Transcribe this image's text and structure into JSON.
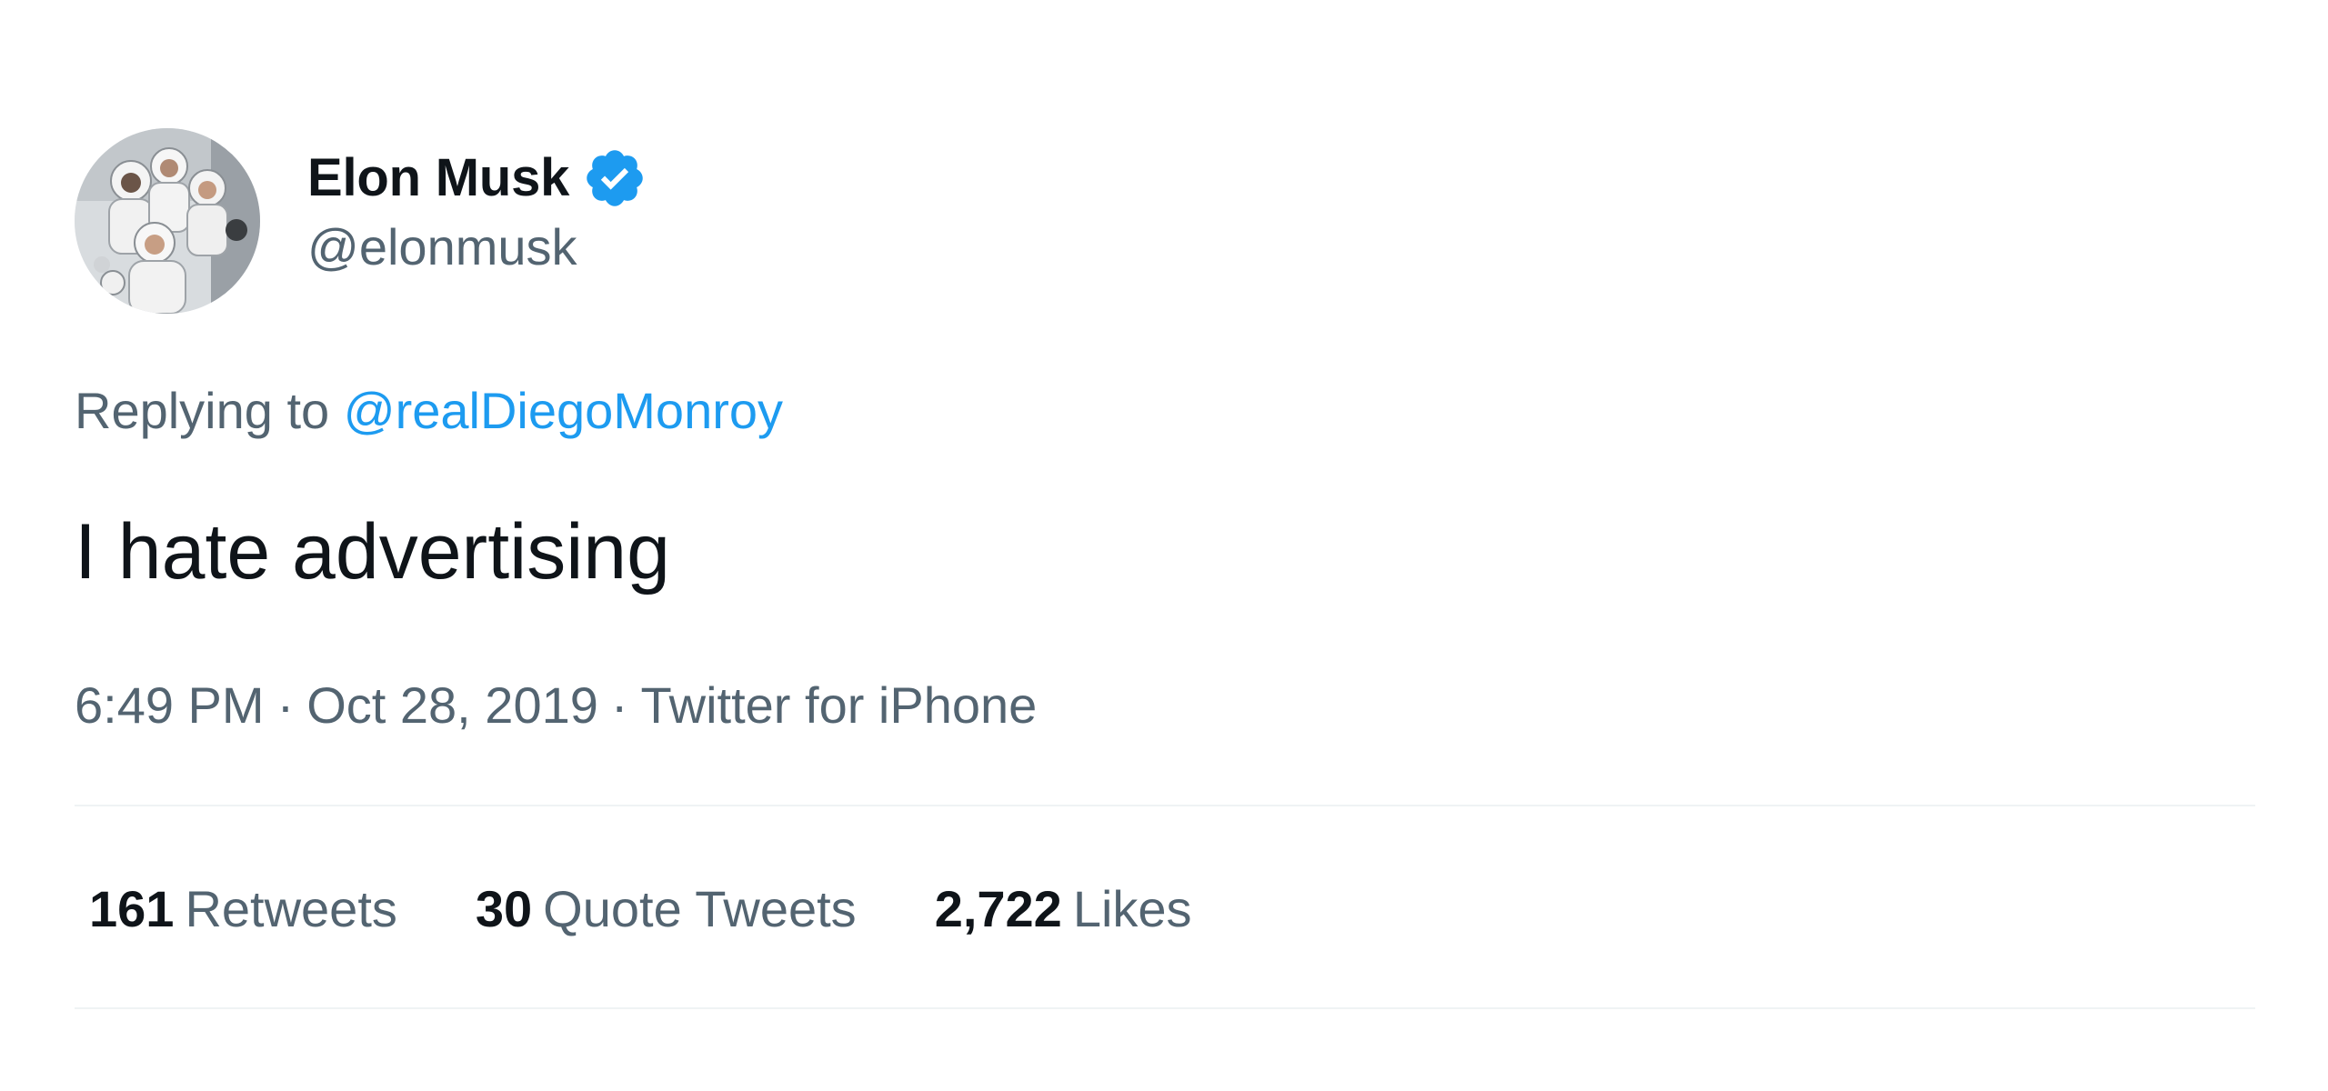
{
  "author": {
    "display_name": "Elon Musk",
    "handle": "@elonmusk",
    "verified_icon": "verified-badge-icon",
    "verified_color": "#1d9bf0"
  },
  "reply": {
    "prefix": "Replying to",
    "to_handle": "@realDiegoMonroy"
  },
  "tweet": {
    "text": "I hate advertising"
  },
  "meta": {
    "time": "6:49 PM",
    "date": "Oct 28, 2019",
    "source": "Twitter for iPhone",
    "separator": "·"
  },
  "stats": [
    {
      "count": "161",
      "label": "Retweets"
    },
    {
      "count": "30",
      "label": "Quote Tweets"
    },
    {
      "count": "2,722",
      "label": "Likes"
    }
  ],
  "colors": {
    "text_primary": "#0f1419",
    "text_secondary": "#536471",
    "link": "#1d9bf0",
    "divider": "#eff3f4"
  }
}
